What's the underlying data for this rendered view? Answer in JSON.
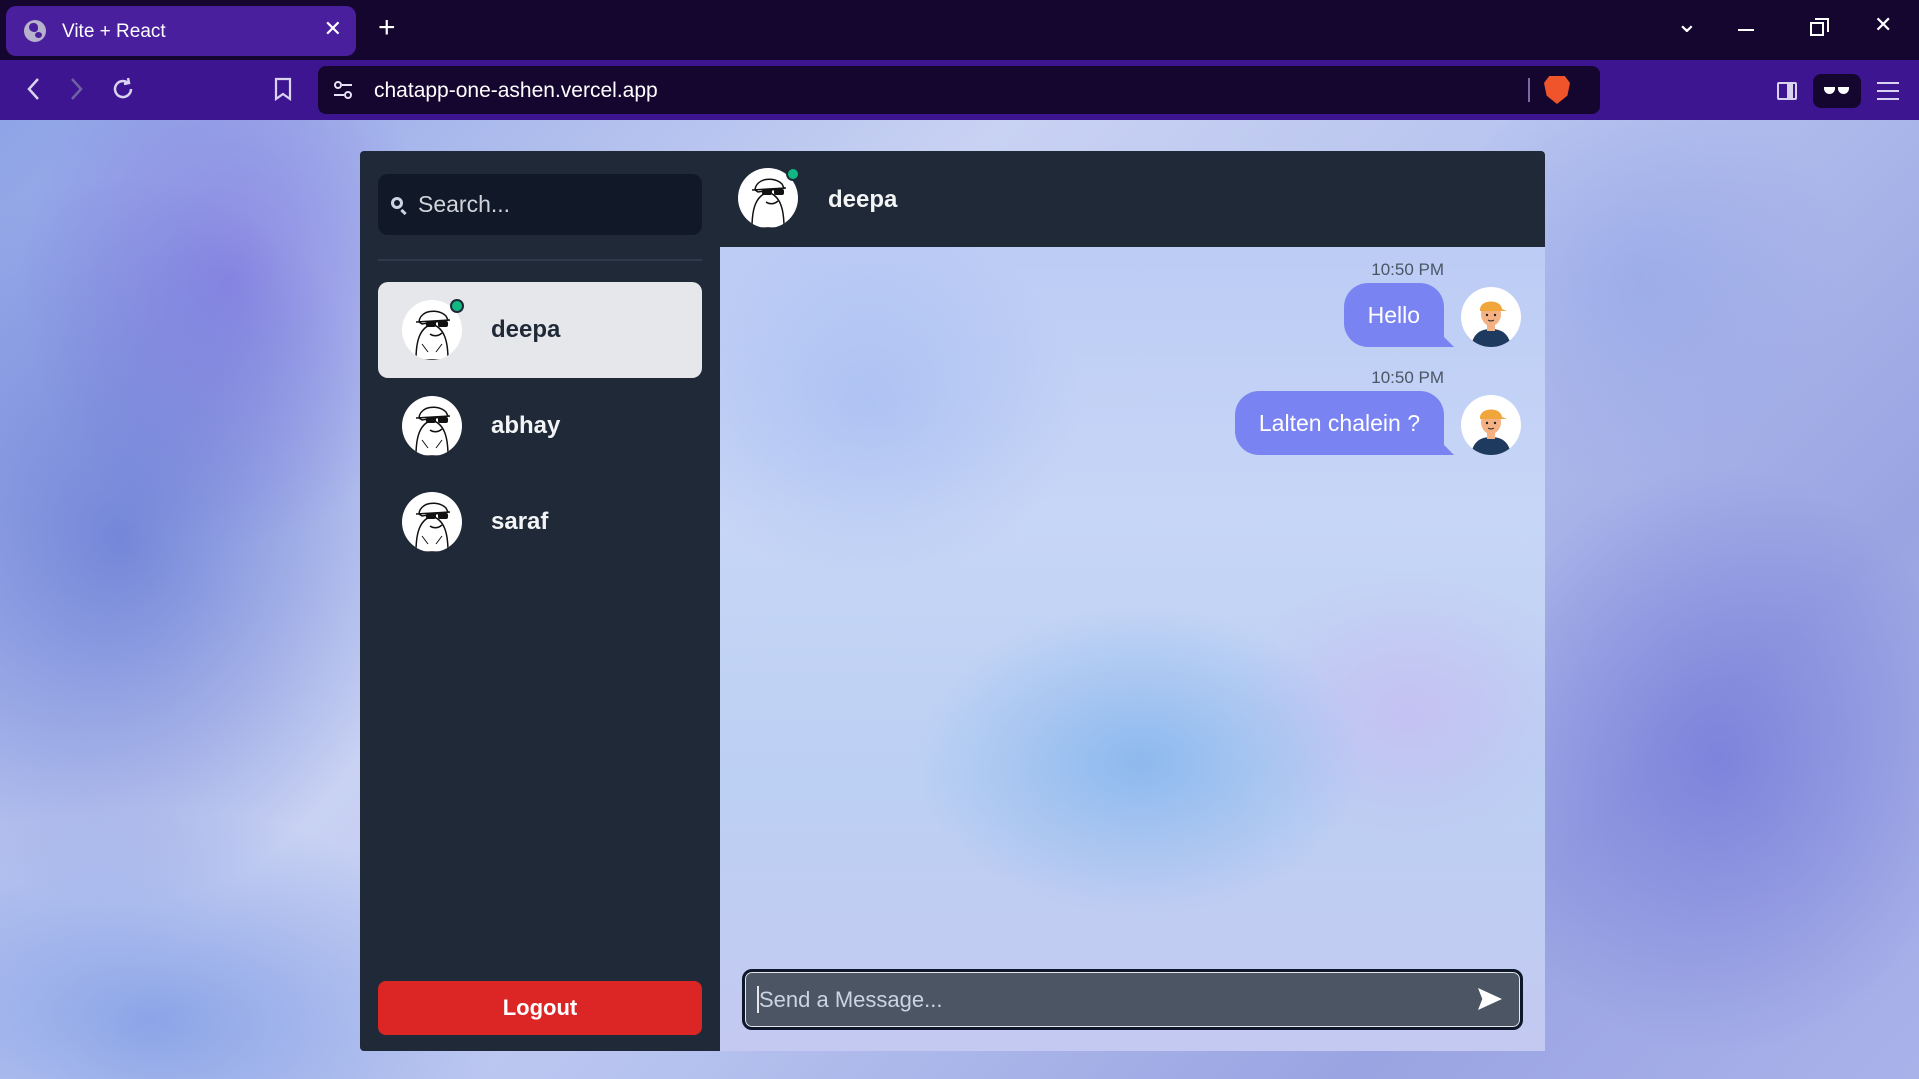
{
  "browser": {
    "tab_title": "Vite + React",
    "tab_close": "✕",
    "new_tab": "+",
    "url": "chatapp-one-ashen.vercel.app",
    "window_controls": {
      "list": "⌄",
      "close": "✕"
    }
  },
  "sidebar": {
    "search_placeholder": "Search...",
    "contacts": [
      {
        "name": "deepa",
        "online": true,
        "selected": true,
        "avatar": "sunglasses-avatar"
      },
      {
        "name": "abhay",
        "online": false,
        "selected": false,
        "avatar": "sunglasses-avatar"
      },
      {
        "name": "saraf",
        "online": false,
        "selected": false,
        "avatar": "sunglasses-avatar"
      }
    ],
    "logout_label": "Logout"
  },
  "chat": {
    "header_name": "deepa",
    "header_online": true,
    "messages": [
      {
        "time": "10:50 PM",
        "text": "Hello",
        "from_me": true,
        "avatar": "cap-avatar"
      },
      {
        "time": "10:50 PM",
        "text": "Lalten chalein ?",
        "from_me": true,
        "avatar": "cap-avatar"
      }
    ],
    "input_placeholder": "Send a Message...",
    "send_icon": "send-icon"
  },
  "colors": {
    "accent_bubble": "#7a83f2",
    "sidebar_bg": "#1f2937",
    "logout": "#dc2626",
    "online": "#10b981",
    "browser_toolbar": "#3d1591"
  }
}
